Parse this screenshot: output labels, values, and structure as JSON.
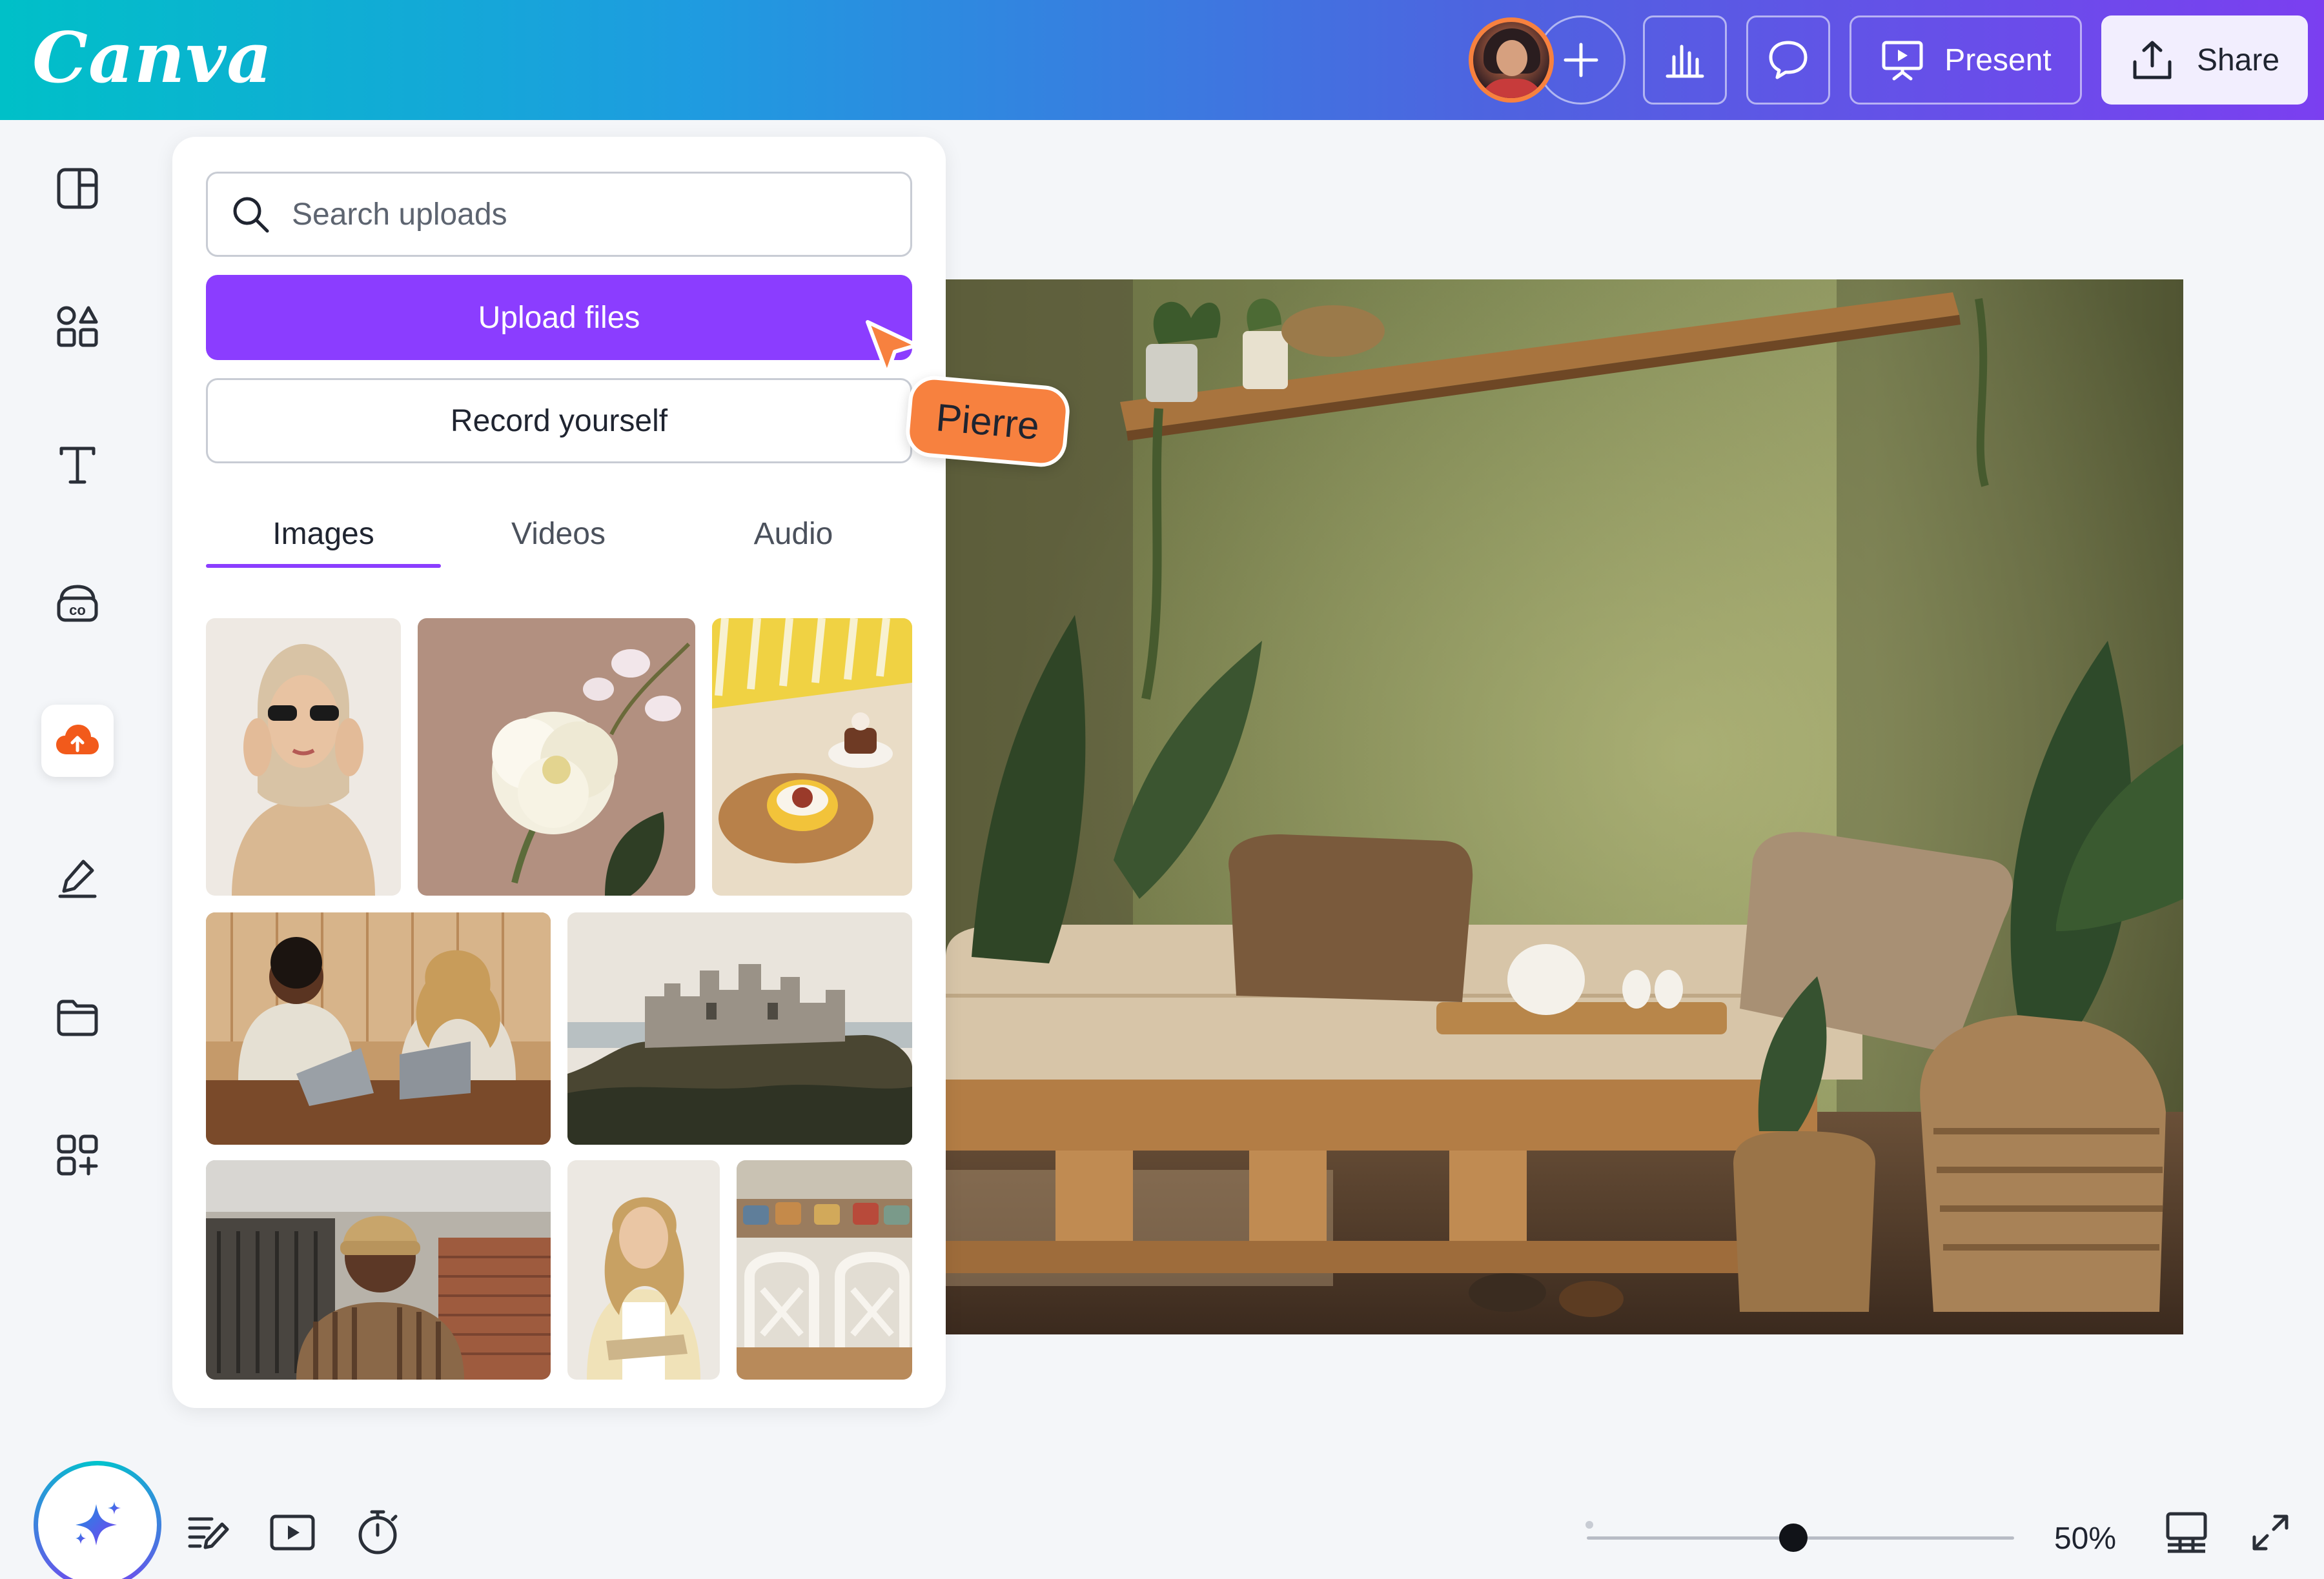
{
  "app": {
    "logo_text": "Canva"
  },
  "topbar": {
    "add_collaborator_label": "+",
    "present_label": "Present",
    "share_label": "Share"
  },
  "sidebar": {
    "items": [
      {
        "name": "design",
        "icon": "layout-icon"
      },
      {
        "name": "elements",
        "icon": "shapes-icon"
      },
      {
        "name": "text",
        "icon": "text-icon"
      },
      {
        "name": "brand",
        "icon": "brand-icon"
      },
      {
        "name": "uploads",
        "icon": "cloud-upload-icon",
        "active": true
      },
      {
        "name": "draw",
        "icon": "draw-icon"
      },
      {
        "name": "projects",
        "icon": "folder-icon"
      },
      {
        "name": "apps",
        "icon": "apps-icon"
      }
    ]
  },
  "uploads_panel": {
    "search_placeholder": "Search uploads",
    "upload_button": "Upload files",
    "record_button": "Record yourself",
    "tabs": [
      {
        "label": "Images",
        "active": true
      },
      {
        "label": "Videos"
      },
      {
        "label": "Audio"
      }
    ]
  },
  "collaborator_cursor": {
    "name": "Pierre",
    "color": "#f7813f"
  },
  "bottom_bar": {
    "zoom_value": "50%",
    "zoom_level_fraction": 0.5
  },
  "colors": {
    "accent_purple": "#8b3dff",
    "collaborator_orange": "#f7813f"
  }
}
